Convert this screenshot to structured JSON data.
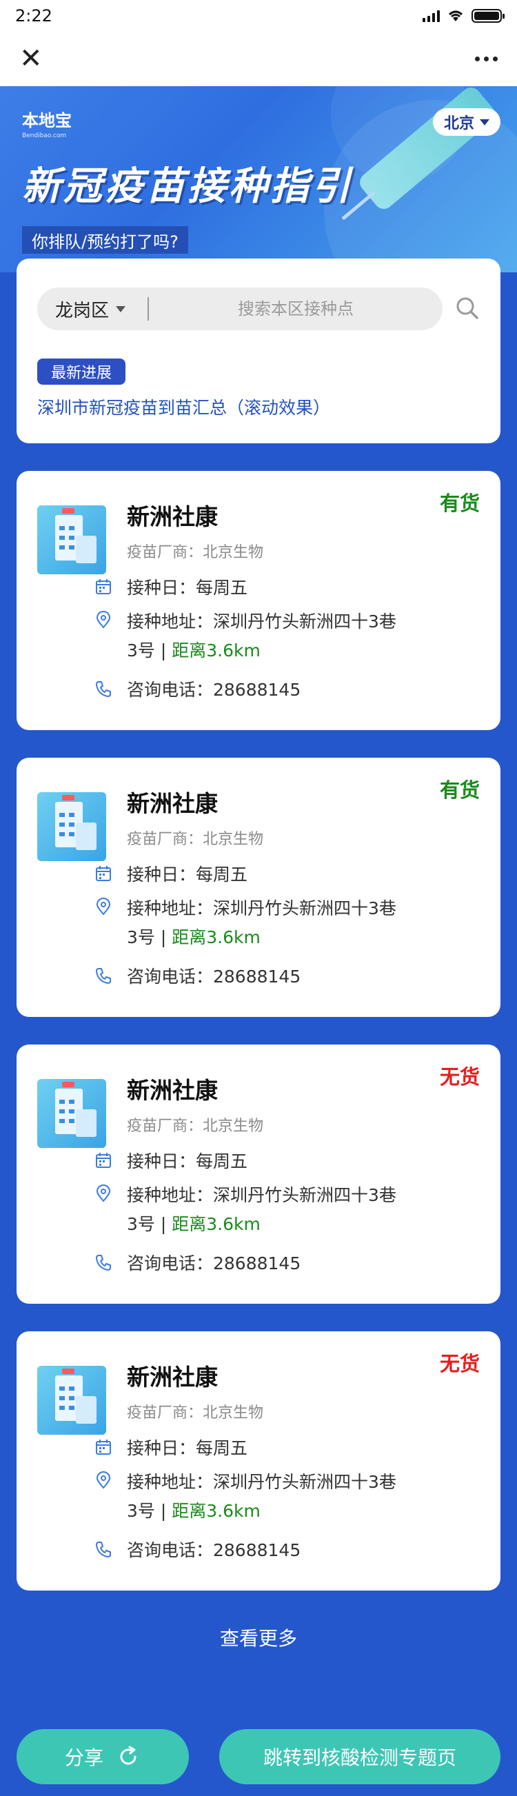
{
  "status_bar": {
    "time": "2:22"
  },
  "nav": {
    "close_icon": "close-icon",
    "more_icon": "more-icon"
  },
  "banner": {
    "logo_text": "本地宝",
    "logo_sub": "Bendibao.com",
    "city": "北京",
    "title": "新冠疫苗接种指引",
    "subtitle": "你排队/预约打了吗?"
  },
  "search": {
    "district": "龙岗区",
    "placeholder": "搜索本区接种点",
    "news_badge": "最新进展",
    "news_link": "深圳市新冠疫苗到苗汇总（滚动效果）"
  },
  "clinics": [
    {
      "name": "新洲社康",
      "stock": "有货",
      "vendor": "疫苗厂商：北京生物",
      "day": "接种日：每周五",
      "address": "接种地址：深圳丹竹头新洲四十3巷3号",
      "distance": "距离3.6km",
      "phone": "咨询电话：28688145"
    },
    {
      "name": "新洲社康",
      "stock": "有货",
      "vendor": "疫苗厂商：北京生物",
      "day": "接种日：每周五",
      "address": "接种地址：深圳丹竹头新洲四十3巷3号",
      "distance": "距离3.6km",
      "phone": "咨询电话：28688145"
    },
    {
      "name": "新洲社康",
      "stock": "无货",
      "vendor": "疫苗厂商：北京生物",
      "day": "接种日：每周五",
      "address": "接种地址：深圳丹竹头新洲四十3巷3号",
      "distance": "距离3.6km",
      "phone": "咨询电话：28688145"
    },
    {
      "name": "新洲社康",
      "stock": "无货",
      "vendor": "疫苗厂商：北京生物",
      "day": "接种日：每周五",
      "address": "接种地址：深圳丹竹头新洲四十3巷3号",
      "distance": "距离3.6km",
      "phone": "咨询电话：28688145"
    }
  ],
  "more": "查看更多",
  "buttons": {
    "share": "分享",
    "jump": "跳转到核酸检测专题页"
  },
  "colors": {
    "background": "#2557cc",
    "in_stock": "#1a8a1a",
    "out_of_stock": "#e41e1e",
    "button": "#3ec6b5"
  }
}
